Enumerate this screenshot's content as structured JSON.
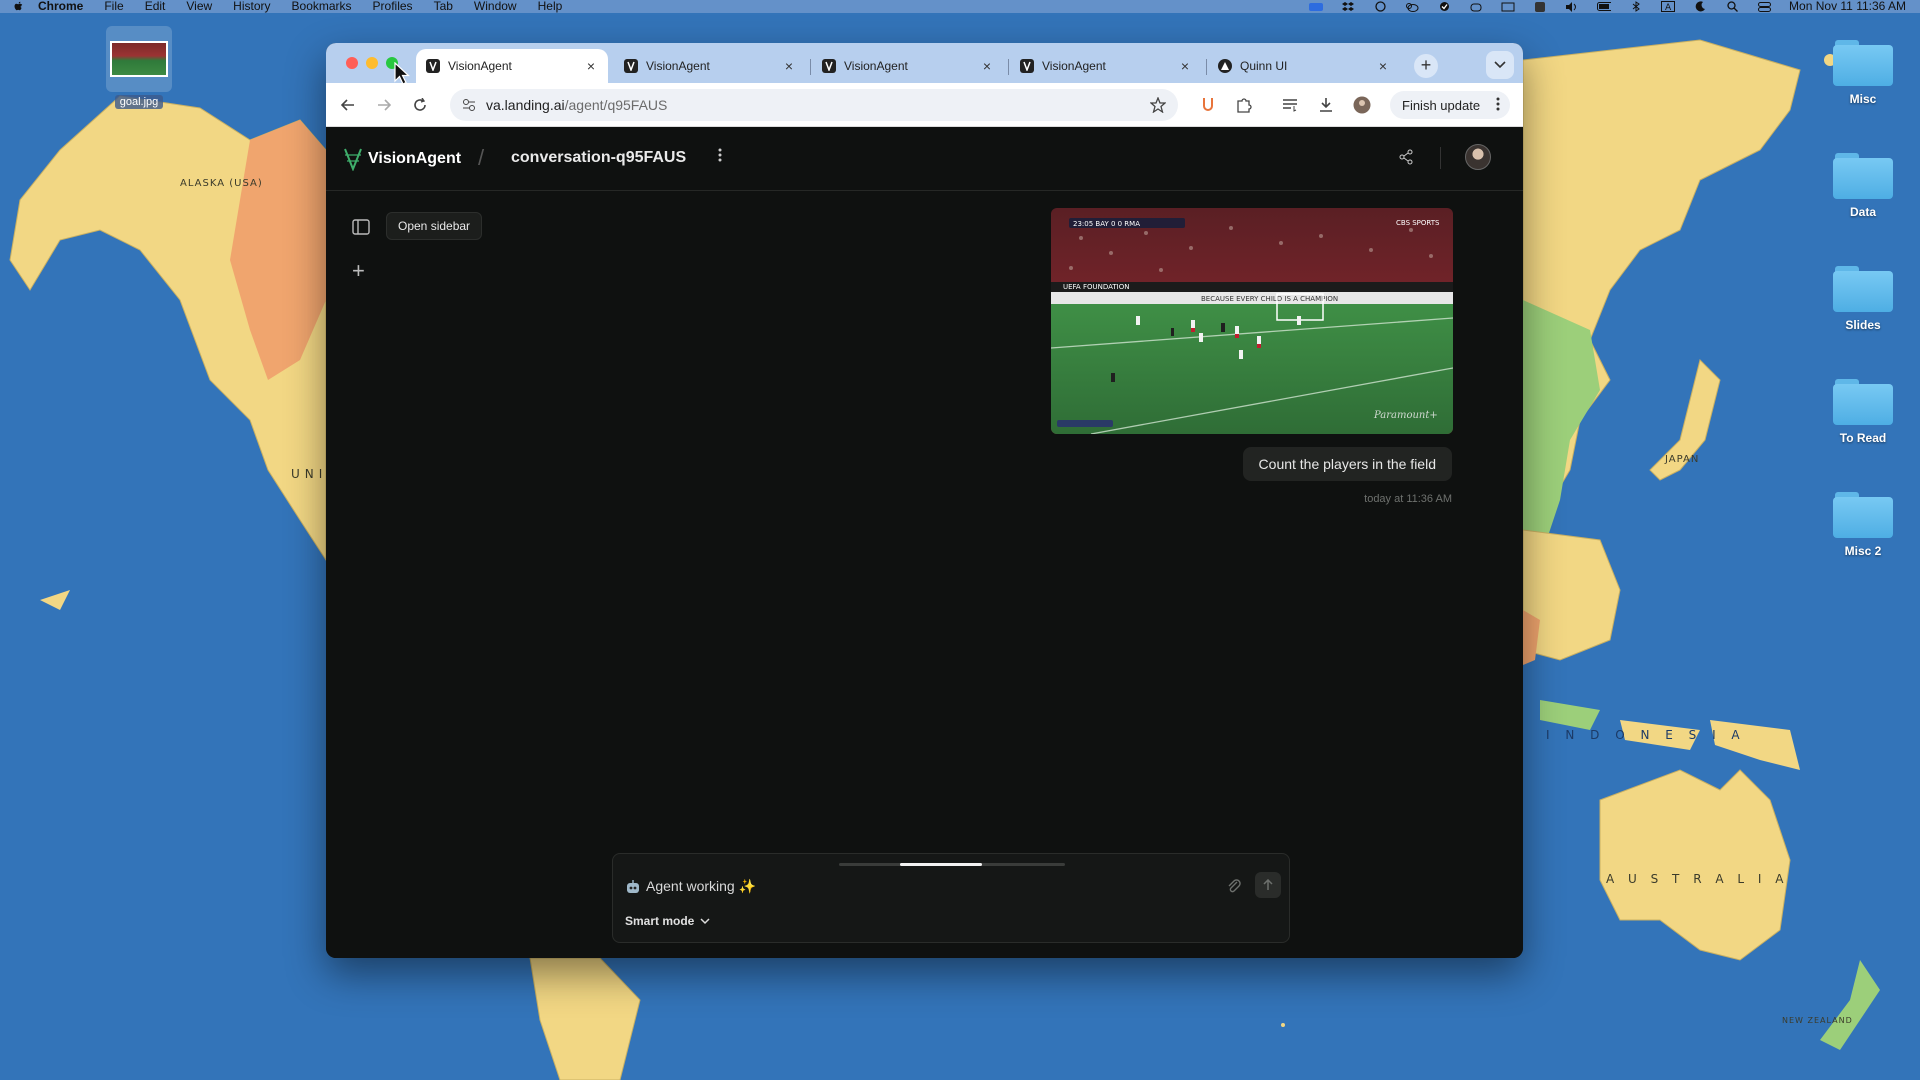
{
  "menubar": {
    "app": "Chrome",
    "items": [
      "File",
      "Edit",
      "View",
      "History",
      "Bookmarks",
      "Profiles",
      "Tab",
      "Window",
      "Help"
    ],
    "clock": "Mon Nov 11  11:36 AM"
  },
  "desktop": {
    "file": {
      "name": "goal.jpg"
    },
    "folders": [
      "Misc",
      "Data",
      "Slides",
      "To Read",
      "Misc 2"
    ],
    "map_labels": [
      "ALASKA (USA)",
      "UNIT",
      "JAPAN",
      "I N D O N E S I A",
      "A U S T R A L I A",
      "NEW ZEALAND"
    ]
  },
  "browser": {
    "tabs": [
      {
        "title": "VisionAgent",
        "active": true
      },
      {
        "title": "VisionAgent",
        "active": false
      },
      {
        "title": "VisionAgent",
        "active": false
      },
      {
        "title": "VisionAgent",
        "active": false
      },
      {
        "title": "Quinn UI",
        "active": false
      }
    ],
    "url_host": "va.landing.ai",
    "url_path": "/agent/q95FAUS",
    "finish_update": "Finish update"
  },
  "app": {
    "brand": "VisionAgent",
    "conversation_title": "conversation-q95FAUS",
    "sidebar_tooltip": "Open sidebar",
    "image_overlay": {
      "scoreboard": "23:05  BAY  0  0  RMA",
      "broadcaster": "CBS SPORTS",
      "watermark": "Paramount+",
      "banner": "BECAUSE EVERY CHILD IS A CHAMPION",
      "foundation": "UEFA FOUNDATION"
    },
    "user_message": "Count the players in the field",
    "timestamp": "today at 11:36 AM",
    "composer": {
      "status": "Agent working ✨",
      "mode": "Smart mode",
      "progress": 0.52
    }
  },
  "colors": {
    "ocean": "#2f6fb4",
    "land_yellow": "#f2d784",
    "land_green": "#9ccf7a",
    "land_orange": "#f0a56e",
    "app_bg": "#0f1110"
  }
}
